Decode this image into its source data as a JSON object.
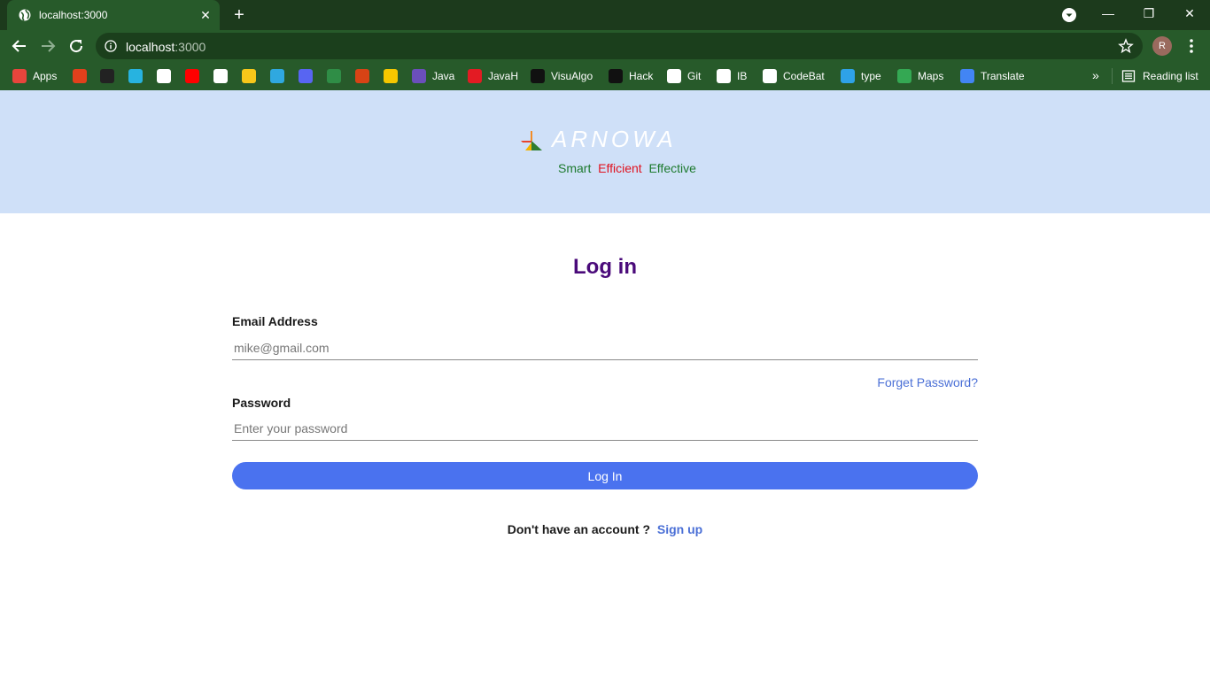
{
  "browser": {
    "tab_title": "localhost:3000",
    "url_host": "localhost",
    "url_port": ":3000",
    "avatar_initial": "R",
    "reading_list": "Reading list",
    "bookmarks": [
      {
        "label": "Apps",
        "color": "#e8453c"
      },
      {
        "label": "",
        "color": "#e2401c"
      },
      {
        "label": "",
        "color": "#222222"
      },
      {
        "label": "",
        "color": "#27b3e0"
      },
      {
        "label": "",
        "color": "#ffffff"
      },
      {
        "label": "",
        "color": "#ff0000"
      },
      {
        "label": "",
        "color": "#ffffff"
      },
      {
        "label": "",
        "color": "#f7c71a"
      },
      {
        "label": "",
        "color": "#2fa8e0"
      },
      {
        "label": "",
        "color": "#5865f2"
      },
      {
        "label": "",
        "color": "#2f8d46"
      },
      {
        "label": "",
        "color": "#d84315"
      },
      {
        "label": "",
        "color": "#f6c700"
      },
      {
        "label": "Java",
        "color": "#6b4fbb"
      },
      {
        "label": "JavaH",
        "color": "#e31b23"
      },
      {
        "label": "VisuAlgo",
        "color": "#111111"
      },
      {
        "label": "Hack",
        "color": "#111111"
      },
      {
        "label": "Git",
        "color": "#ffffff"
      },
      {
        "label": "IB",
        "color": "#ffffff"
      },
      {
        "label": "CodeBat",
        "color": "#ffffff"
      },
      {
        "label": "type",
        "color": "#2ea2e8"
      },
      {
        "label": "Maps",
        "color": "#34a853"
      },
      {
        "label": "Translate",
        "color": "#4285f4"
      }
    ]
  },
  "header": {
    "brand": "ARNOWA",
    "tagline": {
      "smart": "Smart",
      "efficient": "Efficient",
      "effective": "Effective"
    }
  },
  "login": {
    "title": "Log in",
    "email_label": "Email Address",
    "email_placeholder": "mike@gmail.com",
    "forgot": "Forget Password?",
    "password_label": "Password",
    "password_placeholder": "Enter your password",
    "button": "Log In",
    "signup_prompt": "Don't have an account ?",
    "signup_link": "Sign up"
  }
}
